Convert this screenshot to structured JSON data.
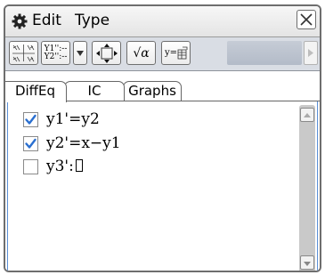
{
  "menubar": {
    "settings_icon": "gear-icon",
    "edit_label": "Edit",
    "type_label": "Type",
    "close_icon": "close-icon"
  },
  "toolbar": {
    "graph_button_icon": "graph-pattern-icon",
    "list_button_top": "Y1'':--",
    "list_button_bottom": "Y2'':--",
    "dropdown_icon": "triangle-down-icon",
    "zoom_fit_icon": "arrows-out-icon",
    "math_button_label": "√α",
    "y_equals_label": "y=",
    "scroll_right_icon": "triangle-right-icon"
  },
  "tabs": [
    {
      "label": "DiffEq",
      "active": true
    },
    {
      "label": "IC",
      "active": false
    },
    {
      "label": "Graphs",
      "active": false
    }
  ],
  "equations": [
    {
      "checked": true,
      "text": "y1'=y2"
    },
    {
      "checked": true,
      "text": "y2'=x−y1"
    },
    {
      "checked": false,
      "text": "y3':"
    }
  ],
  "colors": {
    "checkbox_accent": "#2a6fd0",
    "list_border": "#5a8fd6",
    "toolbar_bg": "#d9dde4"
  }
}
